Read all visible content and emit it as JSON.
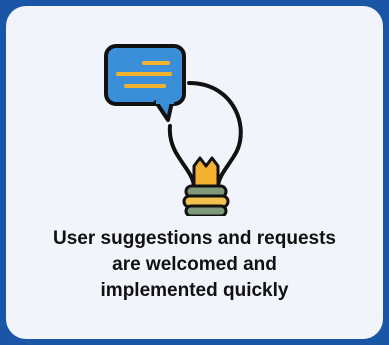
{
  "card": {
    "icon": "lightbulb-with-speech-bubble-icon",
    "caption_lines": [
      "User suggestions and requests",
      "are welcomed and",
      "implemented quickly"
    ]
  },
  "colors": {
    "page_background": "#1a56a6",
    "card_background": "#f1f4fa",
    "bubble_fill": "#3b8fd9",
    "bubble_lines": "#f2b230",
    "filament": "#f2b230",
    "base_green": "#7f9a7a",
    "base_yellow": "#f2c14e"
  }
}
